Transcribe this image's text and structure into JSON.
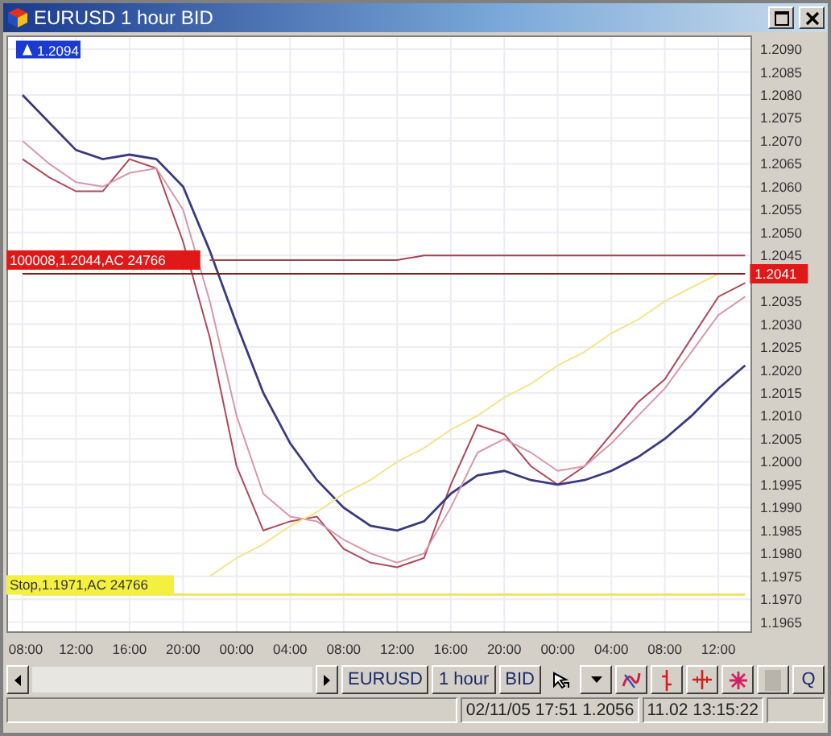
{
  "window": {
    "title": "EURUSD 1 hour BID"
  },
  "chart": {
    "chart_data": {
      "type": "line",
      "categories": [
        "08:00",
        null,
        "12:00",
        null,
        "16:00",
        null,
        "20:00",
        null,
        "00:00",
        null,
        "04:00",
        null,
        "08:00",
        null,
        "12:00",
        null,
        "16:00",
        null,
        "20:00",
        null,
        "00:00",
        null,
        "04:00",
        null,
        "08:00",
        null,
        "12:00",
        null
      ],
      "series": [
        {
          "color": "#b04858",
          "values": [
            1.2066,
            1.2062,
            1.2059,
            1.2059,
            1.2066,
            1.2064,
            1.2048,
            1.2027,
            1.1999,
            1.1985,
            1.1987,
            1.1988,
            1.1981,
            1.1978,
            1.1977,
            1.1979,
            1.1995,
            1.2008,
            1.2006,
            1.1999,
            1.1995,
            1.1999,
            1.2006,
            1.2013,
            1.2018,
            1.2027,
            1.2036,
            1.2039
          ]
        },
        {
          "color": "#3a3a80",
          "values": [
            1.208,
            1.2074,
            1.2068,
            1.2066,
            1.2067,
            1.2066,
            1.206,
            1.2046,
            1.203,
            1.2015,
            1.2004,
            1.1996,
            1.199,
            1.1986,
            1.1985,
            1.1987,
            1.1993,
            1.1997,
            1.1998,
            1.1996,
            1.1995,
            1.1996,
            1.1998,
            1.2001,
            1.2005,
            1.201,
            1.2016,
            1.2021
          ]
        },
        {
          "color": "#d898a8",
          "values": [
            1.207,
            1.2065,
            1.2061,
            1.206,
            1.2063,
            1.2064,
            1.2055,
            1.2035,
            1.201,
            1.1993,
            1.1988,
            1.1987,
            1.1983,
            1.198,
            1.1978,
            1.198,
            1.199,
            1.2002,
            1.2005,
            1.2002,
            1.1998,
            1.1999,
            1.2004,
            1.201,
            1.2016,
            1.2024,
            1.2032,
            1.2036
          ]
        },
        {
          "color": "#f4e48c",
          "values": [
            null,
            null,
            null,
            null,
            null,
            null,
            null,
            1.1975,
            1.1979,
            1.1982,
            1.1986,
            1.1989,
            1.1993,
            1.1996,
            1.2,
            1.2003,
            1.2007,
            1.201,
            1.2014,
            1.2017,
            1.2021,
            1.2024,
            1.2028,
            1.2031,
            1.2035,
            1.2038,
            1.2041,
            null
          ]
        },
        {
          "color": "#a84050",
          "values": [
            null,
            null,
            null,
            null,
            null,
            null,
            null,
            1.2044,
            1.2044,
            1.2044,
            1.2044,
            1.2044,
            1.2044,
            1.2044,
            1.2044,
            1.2045,
            1.2045,
            1.2045,
            1.2045,
            1.2045,
            1.2045,
            1.2045,
            1.2045,
            1.2045,
            1.2045,
            1.2045,
            1.2045,
            1.2045
          ]
        },
        {
          "color": "#802020",
          "values": [
            1.2041,
            1.2041,
            1.2041,
            1.2041,
            1.2041,
            1.2041,
            1.2041,
            1.2041,
            1.2041,
            1.2041,
            1.2041,
            1.2041,
            1.2041,
            1.2041,
            1.2041,
            1.2041,
            1.2041,
            1.2041,
            1.2041,
            1.2041,
            1.2041,
            1.2041,
            1.2041,
            1.2041,
            1.2041,
            1.2041,
            1.2041,
            1.2041
          ]
        },
        {
          "color": "#f0e060",
          "values": [
            1.1971,
            1.1971,
            1.1971,
            1.1971,
            1.1971,
            1.1971,
            1.1971,
            1.1971,
            1.1971,
            1.1971,
            1.1971,
            1.1971,
            1.1971,
            1.1971,
            1.1971,
            1.1971,
            1.1971,
            1.1971,
            1.1971,
            1.1971,
            1.1971,
            1.1971,
            1.1971,
            1.1971,
            1.1971,
            1.1971,
            1.1971,
            1.1971
          ]
        }
      ],
      "ylim": [
        1.1963,
        1.2093
      ],
      "grid": true,
      "yticks": [
        {
          "value": 1.209,
          "label": "1.2090"
        },
        {
          "value": 1.2085,
          "label": "1.2085"
        },
        {
          "value": 1.208,
          "label": "1.2080"
        },
        {
          "value": 1.2075,
          "label": "1.2075"
        },
        {
          "value": 1.207,
          "label": "1.2070"
        },
        {
          "value": 1.2065,
          "label": "1.2065"
        },
        {
          "value": 1.206,
          "label": "1.2060"
        },
        {
          "value": 1.2055,
          "label": "1.2055"
        },
        {
          "value": 1.205,
          "label": "1.2050"
        },
        {
          "value": 1.2045,
          "label": "1.2045"
        },
        {
          "value": 1.2035,
          "label": "1.2035"
        },
        {
          "value": 1.203,
          "label": "1.2030"
        },
        {
          "value": 1.2025,
          "label": "1.2025"
        },
        {
          "value": 1.202,
          "label": "1.2020"
        },
        {
          "value": 1.2015,
          "label": "1.2015"
        },
        {
          "value": 1.201,
          "label": "1.2010"
        },
        {
          "value": 1.2005,
          "label": "1.2005"
        },
        {
          "value": 1.2,
          "label": "1.2000"
        },
        {
          "value": 1.1995,
          "label": "1.1995"
        },
        {
          "value": 1.199,
          "label": "1.1990"
        },
        {
          "value": 1.1985,
          "label": "1.1985"
        },
        {
          "value": 1.198,
          "label": "1.1980"
        },
        {
          "value": 1.1975,
          "label": "1.1975"
        },
        {
          "value": 1.197,
          "label": "1.1970"
        },
        {
          "value": 1.1965,
          "label": "1.1965"
        }
      ],
      "annotations": [
        "1.2094",
        "100008,1.2044,AC 24766",
        "1.2041",
        "Stop,1.1971,AC 24766"
      ]
    }
  },
  "toolbar": {
    "symbol": "EURUSD",
    "period": "1 hour",
    "side": "BID",
    "tools": [
      {
        "kind": "pointer"
      },
      {
        "kind": "dropdown"
      },
      {
        "kind": "wave"
      },
      {
        "kind": "bar"
      },
      {
        "kind": "cross"
      },
      {
        "kind": "star"
      },
      {
        "kind": "blank"
      },
      {
        "kind": "text",
        "label": "Q"
      }
    ]
  },
  "status_bar": {
    "last_tick": "02/11/05 17:51 1.2056",
    "clock": "11.02 13:15:22"
  }
}
